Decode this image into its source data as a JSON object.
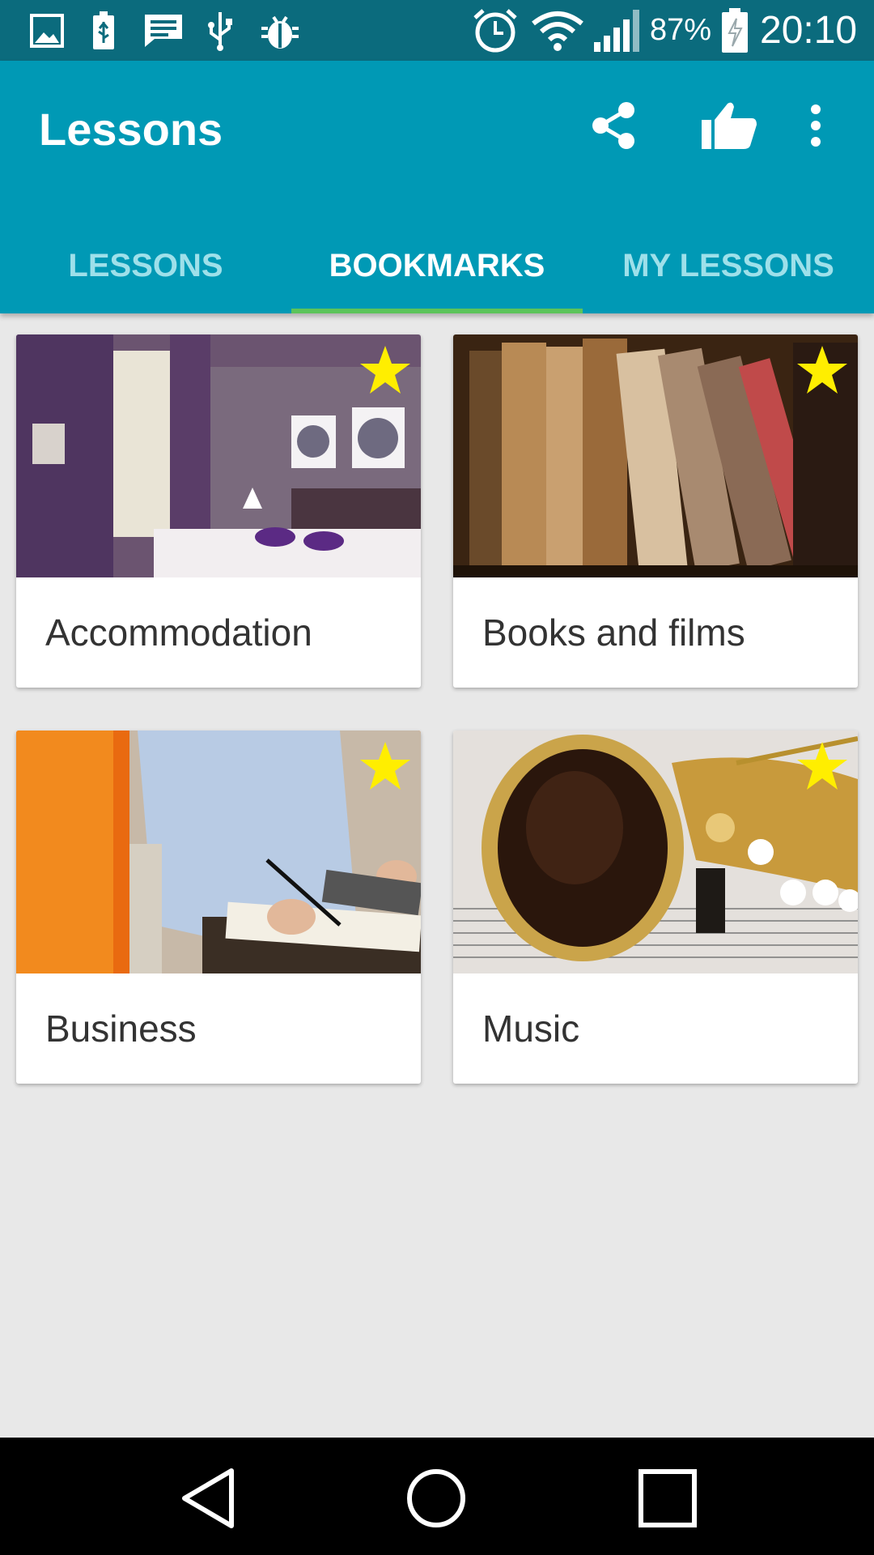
{
  "status_bar": {
    "battery_percent": "87%",
    "time": "20:10",
    "icons": [
      "image-icon",
      "usb-battery-icon",
      "message-icon",
      "usb-icon",
      "bug-icon",
      "alarm-icon",
      "wifi-icon",
      "signal-icon",
      "battery-charging-icon"
    ]
  },
  "app_bar": {
    "title": "Lessons",
    "actions": [
      "share-icon",
      "thumbs-up-icon",
      "more-vert-icon"
    ],
    "color": "#0099b5"
  },
  "tabs": [
    {
      "label": "LESSONS",
      "active": false
    },
    {
      "label": "BOOKMARKS",
      "active": true
    },
    {
      "label": "MY LESSONS",
      "active": false
    }
  ],
  "accent_color": "#5cc45a",
  "cards": [
    {
      "title": "Accommodation",
      "bookmarked": true,
      "image": "hotel-room"
    },
    {
      "title": "Books and films",
      "bookmarked": true,
      "image": "old-books"
    },
    {
      "title": "Business",
      "bookmarked": true,
      "image": "man-writing-at-desk"
    },
    {
      "title": "Music",
      "bookmarked": true,
      "image": "saxophone"
    }
  ],
  "nav_bar": {
    "buttons": [
      "back-icon",
      "home-icon",
      "recents-icon"
    ]
  }
}
